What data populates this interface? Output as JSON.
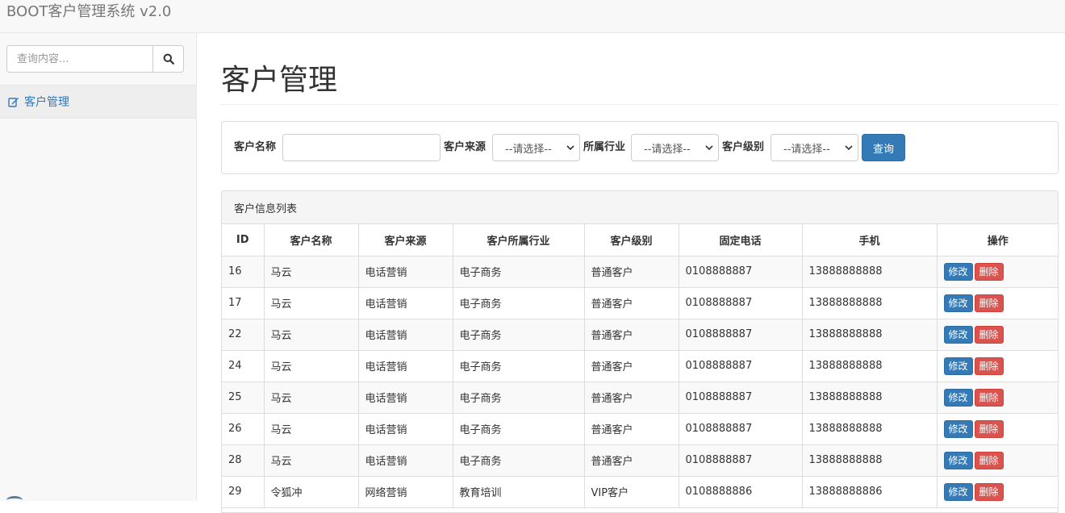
{
  "navbar": {
    "brand": "BOOT客户管理系统 v2.0"
  },
  "sidebar": {
    "search_placeholder": "查询内容...",
    "items": [
      {
        "label": "客户管理",
        "icon": "edit-icon"
      }
    ]
  },
  "page": {
    "title": "客户管理"
  },
  "filter": {
    "name_label": "客户名称",
    "source_label": "客户来源",
    "industry_label": "所属行业",
    "level_label": "客户级别",
    "source_value": "--请选择--",
    "industry_value": "--请选择--",
    "level_value": "--请选择--",
    "query_label": "查询"
  },
  "list": {
    "heading": "客户信息列表",
    "columns": [
      "ID",
      "客户名称",
      "客户来源",
      "客户所属行业",
      "客户级别",
      "固定电话",
      "手机",
      "操作"
    ],
    "edit_label": "修改",
    "delete_label": "删除",
    "rows": [
      [
        "16",
        "马云",
        "电话营销",
        "电子商务",
        "普通客户",
        "0108888887",
        "13888888888"
      ],
      [
        "17",
        "马云",
        "电话营销",
        "电子商务",
        "普通客户",
        "0108888887",
        "13888888888"
      ],
      [
        "22",
        "马云",
        "电话营销",
        "电子商务",
        "普通客户",
        "0108888887",
        "13888888888"
      ],
      [
        "24",
        "马云",
        "电话营销",
        "电子商务",
        "普通客户",
        "0108888887",
        "13888888888"
      ],
      [
        "25",
        "马云",
        "电话营销",
        "电子商务",
        "普通客户",
        "0108888887",
        "13888888888"
      ],
      [
        "26",
        "马云",
        "电话营销",
        "电子商务",
        "普通客户",
        "0108888887",
        "13888888888"
      ],
      [
        "28",
        "马云",
        "电话营销",
        "电子商务",
        "普通客户",
        "0108888887",
        "13888888888"
      ],
      [
        "29",
        "令狐冲",
        "网络营销",
        "教育培训",
        "VIP客户",
        "0108888886",
        "13888888886"
      ]
    ]
  },
  "colors": {
    "primary": "#337ab7",
    "danger": "#d9534f"
  }
}
